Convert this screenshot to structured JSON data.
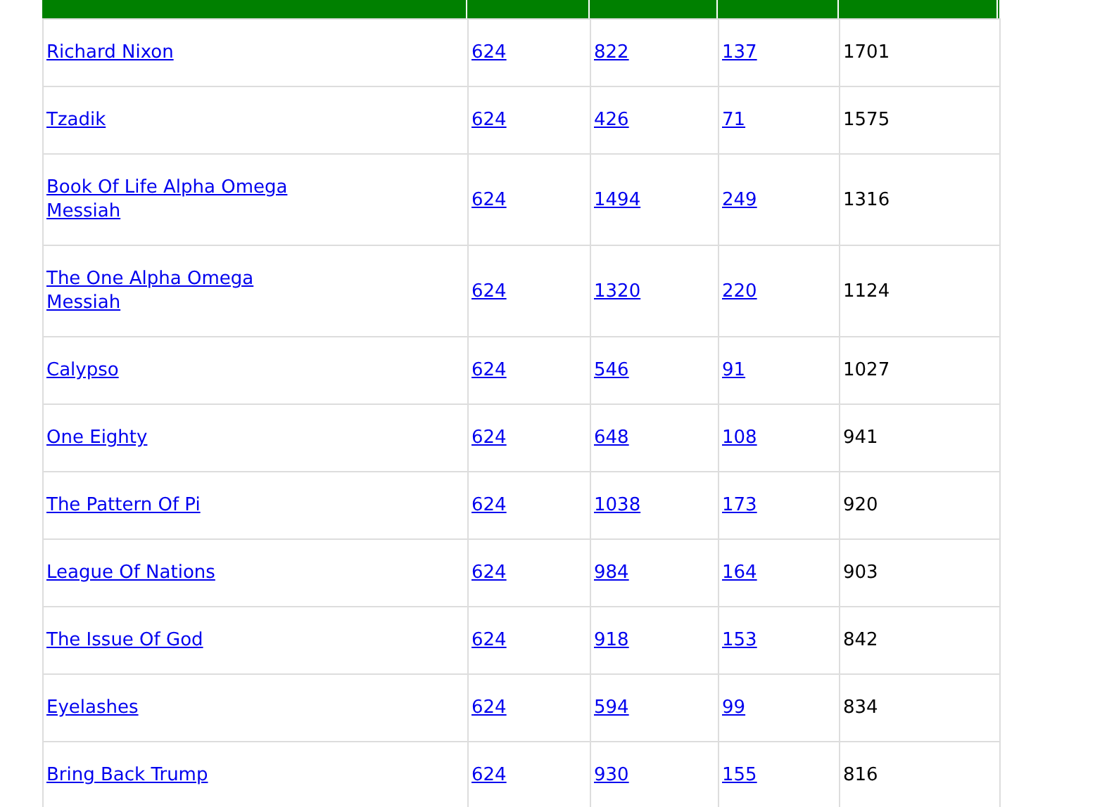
{
  "table": {
    "rows": [
      {
        "name": "Richard Nixon",
        "column_2": "624",
        "column_3": "822",
        "column_4": "137",
        "column_5": "1701"
      },
      {
        "name": "Tzadik",
        "column_2": "624",
        "column_3": "426",
        "column_4": "71",
        "column_5": "1575"
      },
      {
        "name": "Book Of Life Alpha Omega Messiah",
        "column_2": "624",
        "column_3": "1494",
        "column_4": "249",
        "column_5": "1316"
      },
      {
        "name": "The One Alpha Omega Messiah",
        "column_2": "624",
        "column_3": "1320",
        "column_4": "220",
        "column_5": "1124"
      },
      {
        "name": "Calypso",
        "column_2": "624",
        "column_3": "546",
        "column_4": "91",
        "column_5": "1027"
      },
      {
        "name": "One Eighty",
        "column_2": "624",
        "column_3": "648",
        "column_4": "108",
        "column_5": "941"
      },
      {
        "name": "The Pattern Of Pi",
        "column_2": "624",
        "column_3": "1038",
        "column_4": "173",
        "column_5": "920"
      },
      {
        "name": "League Of Nations",
        "column_2": "624",
        "column_3": "984",
        "column_4": "164",
        "column_5": "903"
      },
      {
        "name": "The Issue Of God",
        "column_2": "624",
        "column_3": "918",
        "column_4": "153",
        "column_5": "842"
      },
      {
        "name": "Eyelashes",
        "column_2": "624",
        "column_3": "594",
        "column_4": "99",
        "column_5": "834"
      },
      {
        "name": "Bring Back Trump",
        "column_2": "624",
        "column_3": "930",
        "column_4": "155",
        "column_5": "816"
      }
    ]
  }
}
